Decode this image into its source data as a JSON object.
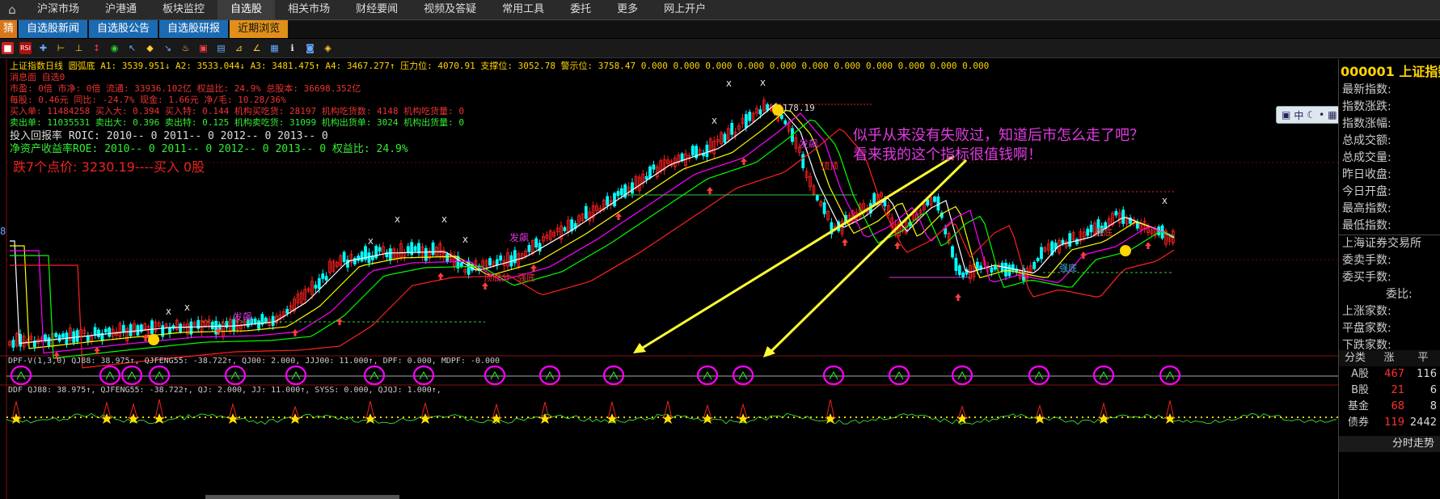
{
  "topnav": {
    "items": [
      "沪深市场",
      "沪港通",
      "板块监控",
      "自选股",
      "相关市场",
      "财经要闻",
      "视频及答疑",
      "常用工具",
      "委托",
      "更多",
      "网上开户"
    ],
    "active_index": 3
  },
  "subnav": {
    "first_label": "猜",
    "items": [
      "自选股新闻",
      "自选股公告",
      "自选股研报",
      "近期浏览"
    ],
    "active_index": 3
  },
  "overlay": {
    "header_line": "上证指数日线 圆弧底 A1: 3539.951↓ A2: 3533.044↓ A3: 3481.475↑ A4: 3467.277↑ 压力位: 4070.91 支撑位: 3052.78 警示位: 3758.47 0.000 0.000 0.000 0.000 0.000 0.000 0.000 0.000 0.000 0.000 0.000",
    "line2": "消息面 自选0",
    "line3": "市盈: 0倍    市净: 0倍    流通: 33936.102亿   权益比: 24.9%    总股本: 36698.352亿",
    "line4": "每股: 0.46元    同比: -24.7%    现金: 1.66元    净/毛: 10.28/36%",
    "line5": "买入单: 11484258   买入大: 0.394   买入特: 0.144   机构买吃货: 28197  机构吃货数: 4148   机构吃货量: 0",
    "line6": "卖出单: 11035531   卖出大: 0.396   卖出特: 0.125   机构卖吃货: 31099  机构出货单: 3024   机构出货量: 0",
    "roic_line": "投入回报率 ROIC: 2010-- 0    2011-- 0    2012-- 0    2013-- 0",
    "roe_line": "净资产收益率ROE: 2010-- 0    2011-- 0    2012-- 0    2013-- 0    权益比: 24.9%",
    "drop_line": "跌7个点价: 3230.19----买入 0股",
    "price_tag": "178.19",
    "sub1_label": "DPF-V(1,3,0) QJ88: 38.975↑, QJFENG55: -38.722↑, QJ00: 2.000, JJJ00: 11.000↑, DPF: 0.000, MDPF: -0.000",
    "sub2_label": "DDF QJ88: 38.975↑, QJFENG55: -38.722↑, QJ: 2.000, JJ: 11.000↑, SYSS: 0.000, QJQJ: 1.000↑,",
    "fabao_labels": [
      "发飙",
      "发飙",
      "发飙"
    ],
    "annotations": [
      "顶底分",
      "强底",
      "强底",
      "强底",
      "顶顶"
    ],
    "comment_line1": "似乎从来没有失败过，知道后市怎么走了吧？",
    "comment_line2": "看来我的这个指标很值钱啊！",
    "left_edge_mark": "8"
  },
  "sidebar": {
    "title": "000001 上证指数",
    "rows": [
      "最新指数:",
      "指数涨跌:",
      "指数涨幅:",
      "总成交额:",
      "总成交量:",
      "昨日收盘:",
      "今日开盘:",
      "最高指数:",
      "最低指数:",
      "上海证券交易所",
      "委卖手数:",
      "委买手数:",
      "委比:",
      "上涨家数:",
      "平盘家数:",
      "下跌家数:"
    ],
    "table_header": [
      "分类",
      "涨",
      "平"
    ],
    "table_rows": [
      {
        "name": "A股",
        "up": "467",
        "flat": "116"
      },
      {
        "name": "B股",
        "up": "21",
        "flat": "6"
      },
      {
        "name": "基金",
        "up": "68",
        "flat": "8"
      },
      {
        "name": "债券",
        "up": "119",
        "flat": "2442"
      }
    ],
    "footer": "分时走势"
  },
  "floatbar": {
    "label": "中"
  },
  "colors": {
    "up": "#ff2020",
    "down": "#00ffff",
    "ma5": "#ffffff",
    "ma10": "#ffff00",
    "ma20": "#ff00ff",
    "ma30": "#00ff00",
    "ma60": "#ff2020",
    "circle": "#ff00ff",
    "arrow": "#ffff33"
  }
}
